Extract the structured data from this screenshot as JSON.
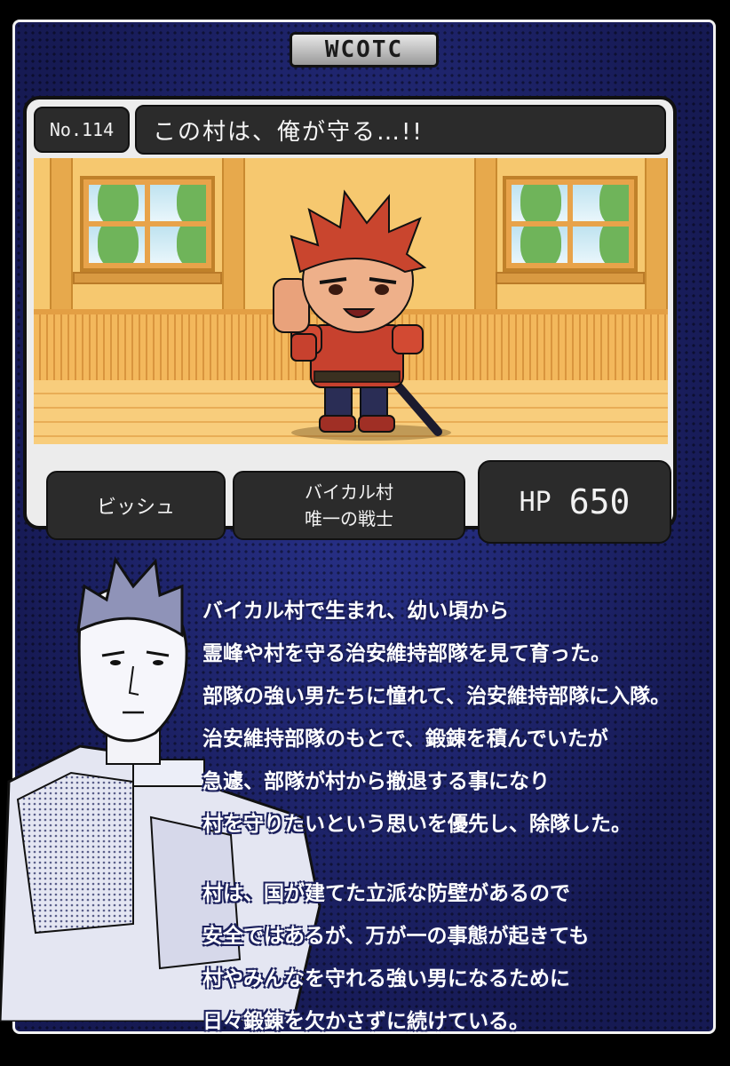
{
  "logo": {
    "text": "WCOTC"
  },
  "card": {
    "number": "No.114",
    "quote": "この村は、俺が守る…!!",
    "name": "ビッシュ",
    "title_line1": "バイカル村",
    "title_line2": "唯一の戦士",
    "hp_label": "HP",
    "hp_value": "650"
  },
  "description": {
    "paragraph1": [
      "バイカル村で生まれ、幼い頃から",
      "霊峰や村を守る治安維持部隊を見て育った。",
      "部隊の強い男たちに憧れて、治安維持部隊に入隊。",
      "治安維持部隊のもとで、鍛錬を積んでいたが",
      "急遽、部隊が村から撤退する事になり",
      "村を守りたいという思いを優先し、除隊した。"
    ],
    "paragraph2": [
      "村は、国が建てた立派な防壁があるので",
      "安全ではあるが、万が一の事態が起きても",
      "村やみんなを守れる強い男になるために",
      "日々鍛錬を欠かさずに続けている。"
    ]
  },
  "colors": {
    "background": "#1e2470",
    "panel": "#2b2b2b",
    "text": "#ffffff",
    "hair": "#c9452e"
  }
}
